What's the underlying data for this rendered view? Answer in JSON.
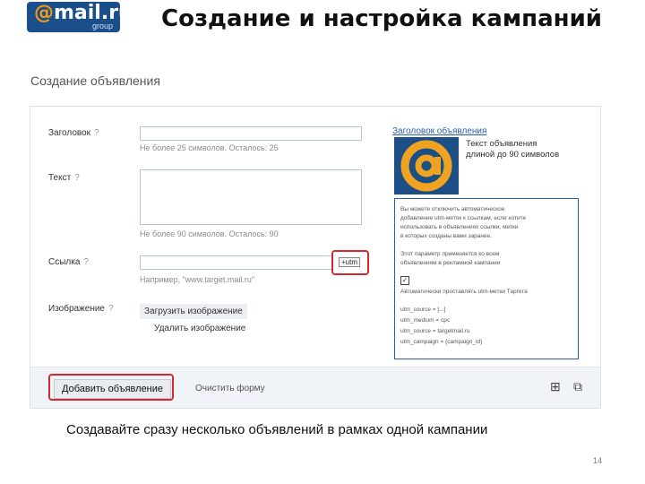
{
  "logo": {
    "brand": "@mail.ru",
    "at": "@",
    "mail": "mail.ru",
    "group": "group"
  },
  "slide_title": "Создание и настройка кампаний",
  "section_title": "Создание объявления",
  "form": {
    "title_label": "Заголовок",
    "title_value": "",
    "title_hint": "Не более 25 символов. Осталось: 25",
    "text_label": "Текст",
    "text_value": "",
    "text_hint": "Не более 90 символов. Осталось: 90",
    "link_label": "Ссылка",
    "link_value": "",
    "link_hint": "Например, \"www.target.mail.ru\"",
    "link_button": "+utm",
    "image_label": "Изображение",
    "upload_image": "Загрузить изображение",
    "delete_image": "Удалить изображение",
    "help": "?"
  },
  "preview": {
    "title": "Заголовок объявления",
    "text": "Текст объявления длиной до 90 символов",
    "info_lines": [
      "Вы можете отключить автоматическое",
      "добавление utm-меток к ссылкам, если хотите",
      "использовать в объявлениях ссылки, метки",
      "в которых созданы вами заранее.",
      "Этот параметр применяется ко всем",
      "объявлениям в рекламной кампании",
      "Автоматически проставлять utm-метки Таргета",
      "utm_source = [...]",
      "utm_medium = cpc",
      "utm_source = targetmail.ru",
      "utm_campaign = {campaign_id}"
    ]
  },
  "footer": {
    "add_button": "Добавить объявление",
    "clear_link": "Очистить форму"
  },
  "caption": "Создавайте сразу несколько объявлений в рамках одной кампании",
  "page_number": "14",
  "colors": {
    "accent": "#d9272e",
    "brand": "#1a4f8b",
    "link": "#2a5ea8"
  }
}
